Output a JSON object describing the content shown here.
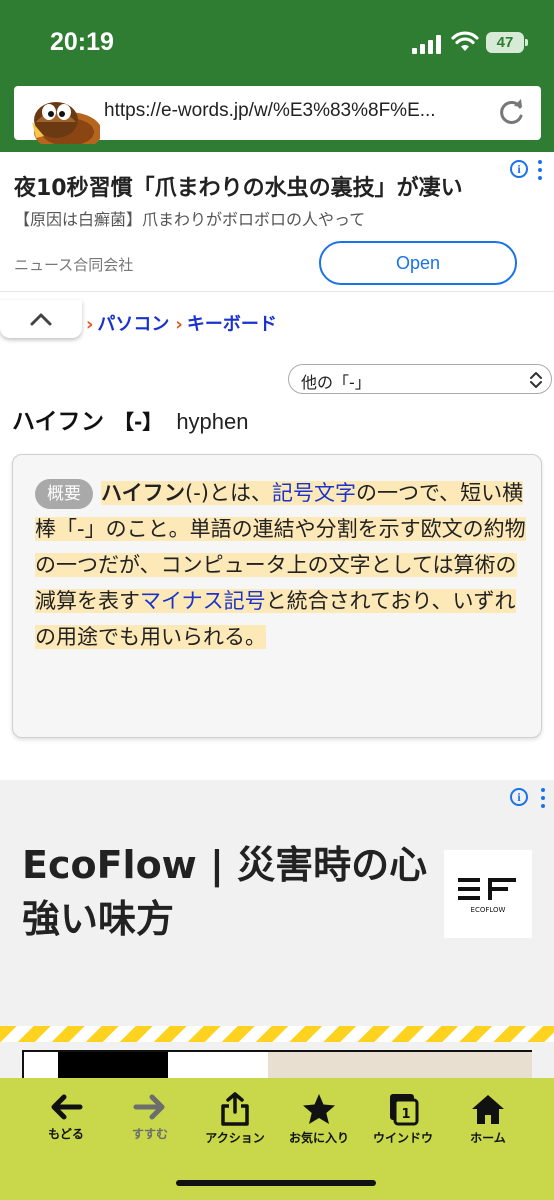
{
  "status_bar": {
    "time": "20:19",
    "battery": "47"
  },
  "browser": {
    "url": "https://e-words.jp/w/%E3%83%8F%E..."
  },
  "ad_top": {
    "headline": "夜10秒習慣「爪まわりの水虫の裏技」が凄い",
    "sub": "【原因は白癬菌】爪まわりがボロボロの人やって",
    "advertiser": "ニュース合同会社",
    "cta": "Open",
    "info_icon": "info-icon",
    "menu_icon": "kebab-menu-icon"
  },
  "breadcrumb": {
    "sep": "›",
    "items": [
      "パソコン",
      "キーボード"
    ]
  },
  "other_select": {
    "value": "他の「-」"
  },
  "term": {
    "name": "ハイフン",
    "symbol": "【-】",
    "english": "hyphen"
  },
  "summary": {
    "badge": "概要",
    "t0": "ハイフン",
    "t1": "(-)とは、",
    "t2": "記号文字",
    "t3": "の一つで、短い横棒「-」のこと。単語の連結や分割を示す欧文の約物の一つだが、コンピュータ上の文字としては算術の減算を表す",
    "t4": "マイナス記号",
    "t5": "と統合されており、いずれの用途でも用いられる。"
  },
  "ad_bottom": {
    "title": "EcoFlow | 災害時の心強い味方",
    "logo_text": "ECOFLOW"
  },
  "bottom_nav": {
    "back": "もどる",
    "forward": "すすむ",
    "action": "アクション",
    "favorites": "お気に入り",
    "window": "ウインドウ",
    "window_count": "1",
    "home": "ホーム"
  },
  "colors": {
    "browser_green": "#2f7d32",
    "toolbar_lime": "#c8d84a",
    "link_blue": "#1a33cc",
    "highlight": "#fde9b8",
    "breadcrumb_arrow": "#e8531b"
  }
}
